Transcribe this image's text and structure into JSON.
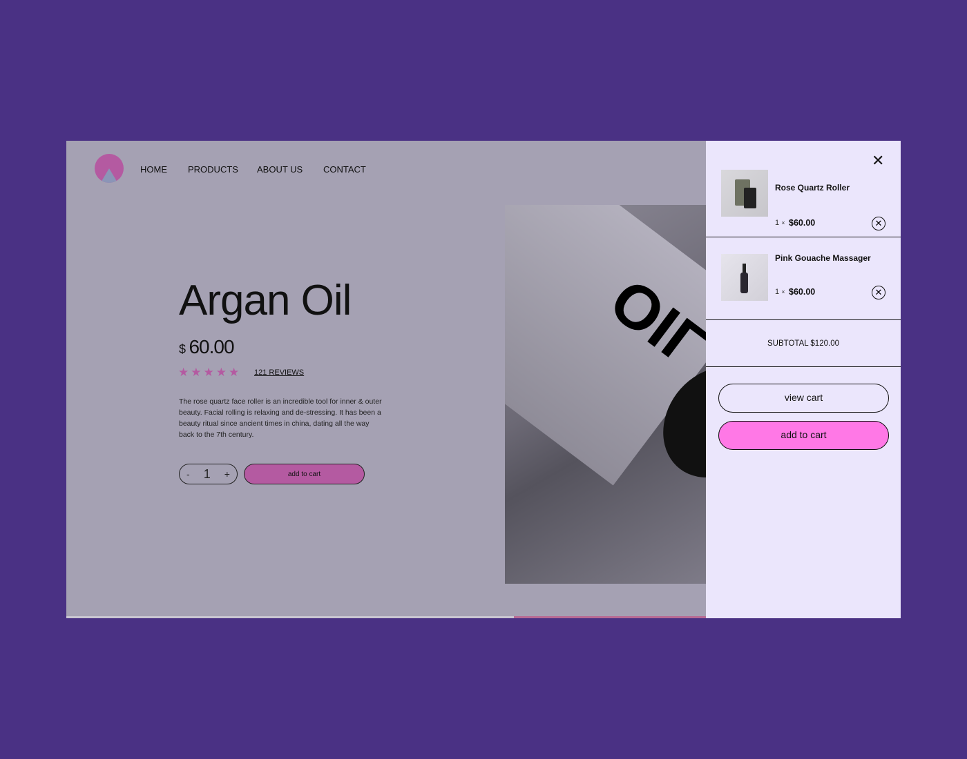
{
  "nav": {
    "items": [
      "HOME",
      "PRODUCTS",
      "ABOUT US",
      "CONTACT"
    ]
  },
  "product": {
    "title": "Argan Oil",
    "currency": "$",
    "price": "60.00",
    "rating": 5,
    "reviews": "121 REVIEWS",
    "description": "The rose quartz face roller is an incredible tool for inner & outer beauty. Facial rolling is relaxing and de-stressing. It has been a beauty ritual since ancient times in china, dating all the way back to the 7th century.",
    "qty_minus": "-",
    "qty": "1",
    "qty_plus": "+",
    "add_to_cart": "add to cart",
    "hero_text": "OIL"
  },
  "cart": {
    "items": [
      {
        "name": "Rose Quartz Roller",
        "qty": "1",
        "times": "×",
        "price": "$60.00"
      },
      {
        "name": "Pink Gouache Massager",
        "qty": "1",
        "times": "×",
        "price": "$60.00"
      }
    ],
    "subtotal": "SUBTOTAL $120.00",
    "view_cart": "view cart",
    "add_to_cart": "add to cart"
  },
  "colors": {
    "background": "#4a3184",
    "overlay": "#a5a1b3",
    "accent": "#b45aa1",
    "cart_bg": "#ebe6fc",
    "cart_button": "#ff78e6"
  }
}
